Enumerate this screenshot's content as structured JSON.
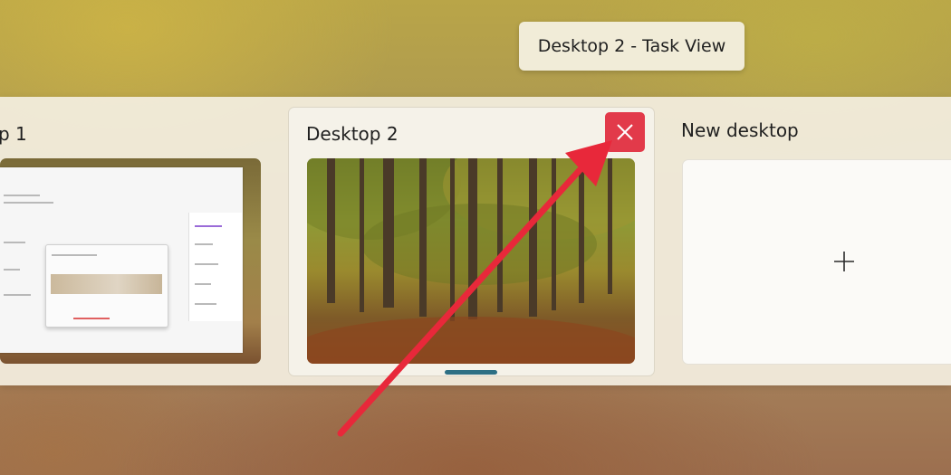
{
  "tooltip": {
    "text": "Desktop 2 - Task View"
  },
  "desktops": [
    {
      "label": "p 1",
      "active": false
    },
    {
      "label": "Desktop 2",
      "active": true
    }
  ],
  "new_desktop": {
    "label": "New desktop",
    "plus_icon": "plus-icon"
  },
  "close_icon": "close-icon",
  "colors": {
    "close_button": "#e23a4a",
    "active_indicator": "#2d6f84",
    "annotation_arrow": "#e8283a"
  }
}
